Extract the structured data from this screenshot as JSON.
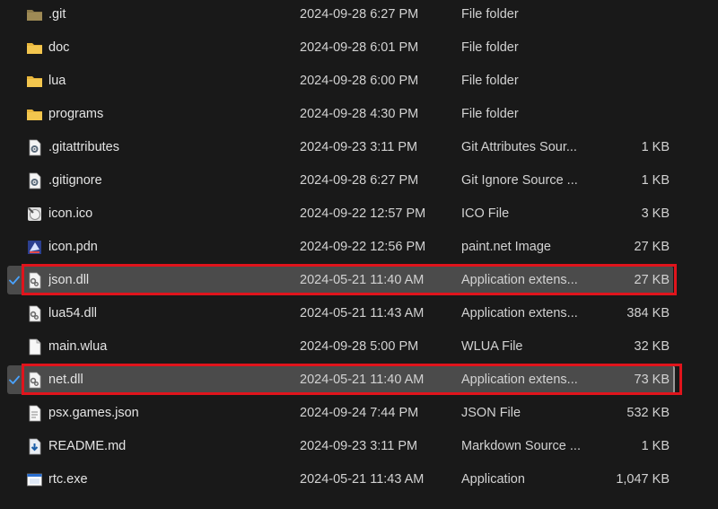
{
  "accent_colors": {
    "selection": "#4b4b4b",
    "highlight_box": "#e0141c",
    "folder": "#e7b53c",
    "check": "#4aa3ff"
  },
  "files": [
    {
      "name": ".git",
      "date": "2024-09-28 6:27 PM",
      "type": "File folder",
      "size": "",
      "icon": "folder-dim-icon",
      "selected": false
    },
    {
      "name": "doc",
      "date": "2024-09-28 6:01 PM",
      "type": "File folder",
      "size": "",
      "icon": "folder-icon",
      "selected": false
    },
    {
      "name": "lua",
      "date": "2024-09-28 6:00 PM",
      "type": "File folder",
      "size": "",
      "icon": "folder-icon",
      "selected": false
    },
    {
      "name": "programs",
      "date": "2024-09-28 4:30 PM",
      "type": "File folder",
      "size": "",
      "icon": "folder-icon",
      "selected": false
    },
    {
      "name": ".gitattributes",
      "date": "2024-09-23 3:11 PM",
      "type": "Git Attributes Sour...",
      "size": "1 KB",
      "icon": "settings-file-icon",
      "selected": false
    },
    {
      "name": ".gitignore",
      "date": "2024-09-28 6:27 PM",
      "type": "Git Ignore Source ...",
      "size": "1 KB",
      "icon": "settings-file-icon",
      "selected": false
    },
    {
      "name": "icon.ico",
      "date": "2024-09-22 12:57 PM",
      "type": "ICO File",
      "size": "3 KB",
      "icon": "ico-file-icon",
      "selected": false
    },
    {
      "name": "icon.pdn",
      "date": "2024-09-22 12:56 PM",
      "type": "paint.net Image",
      "size": "27 KB",
      "icon": "paintnet-file-icon",
      "selected": false
    },
    {
      "name": "json.dll",
      "date": "2024-05-21 11:40 AM",
      "type": "Application extens...",
      "size": "27 KB",
      "icon": "dll-file-icon",
      "selected": true
    },
    {
      "name": "lua54.dll",
      "date": "2024-05-21 11:43 AM",
      "type": "Application extens...",
      "size": "384 KB",
      "icon": "dll-file-icon",
      "selected": false
    },
    {
      "name": "main.wlua",
      "date": "2024-09-28 5:00 PM",
      "type": "WLUA File",
      "size": "32 KB",
      "icon": "blank-file-icon",
      "selected": false
    },
    {
      "name": "net.dll",
      "date": "2024-05-21 11:40 AM",
      "type": "Application extens...",
      "size": "73 KB",
      "icon": "dll-file-icon",
      "selected": true,
      "focused": true
    },
    {
      "name": "psx.games.json",
      "date": "2024-09-24 7:44 PM",
      "type": "JSON File",
      "size": "532 KB",
      "icon": "text-file-icon",
      "selected": false
    },
    {
      "name": "README.md",
      "date": "2024-09-23 3:11 PM",
      "type": "Markdown Source ...",
      "size": "1 KB",
      "icon": "markdown-file-icon",
      "selected": false
    },
    {
      "name": "rtc.exe",
      "date": "2024-05-21 11:43 AM",
      "type": "Application",
      "size": "1,047 KB",
      "icon": "exe-file-icon",
      "selected": false
    }
  ]
}
